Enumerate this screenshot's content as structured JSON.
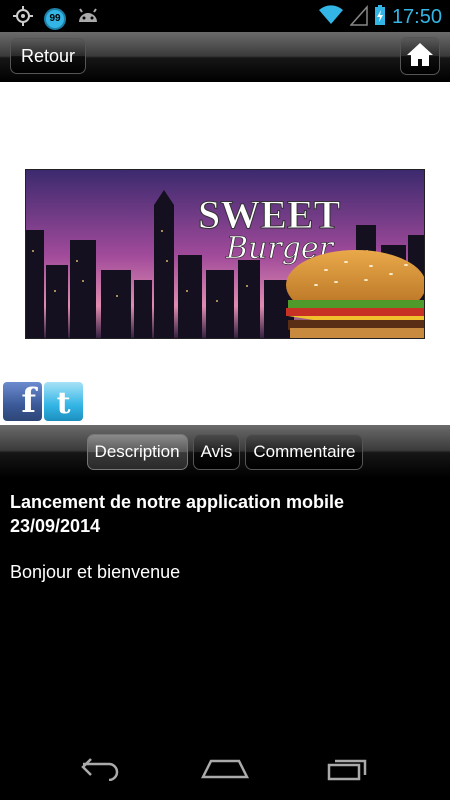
{
  "status_bar": {
    "notification_badge": "99",
    "time": "17:50",
    "icons": [
      "gps-icon",
      "notification-badge-icon",
      "android-icon",
      "wifi-icon",
      "signal-icon",
      "battery-charging-icon"
    ]
  },
  "header": {
    "back_label": "Retour",
    "home_icon": "home-icon"
  },
  "banner": {
    "title_line1": "SWEET",
    "title_line2": "Burger"
  },
  "social": {
    "facebook_glyph": "f",
    "twitter_glyph": "t"
  },
  "tabs": [
    {
      "label": "Description",
      "active": true
    },
    {
      "label": "Avis",
      "active": false
    },
    {
      "label": "Commentaire",
      "active": false
    }
  ],
  "article": {
    "title": "Lancement de notre application mobile",
    "date": "23/09/2014",
    "body": "Bonjour et bienvenue"
  },
  "colors": {
    "accent": "#33b5e5",
    "background": "#000000"
  }
}
